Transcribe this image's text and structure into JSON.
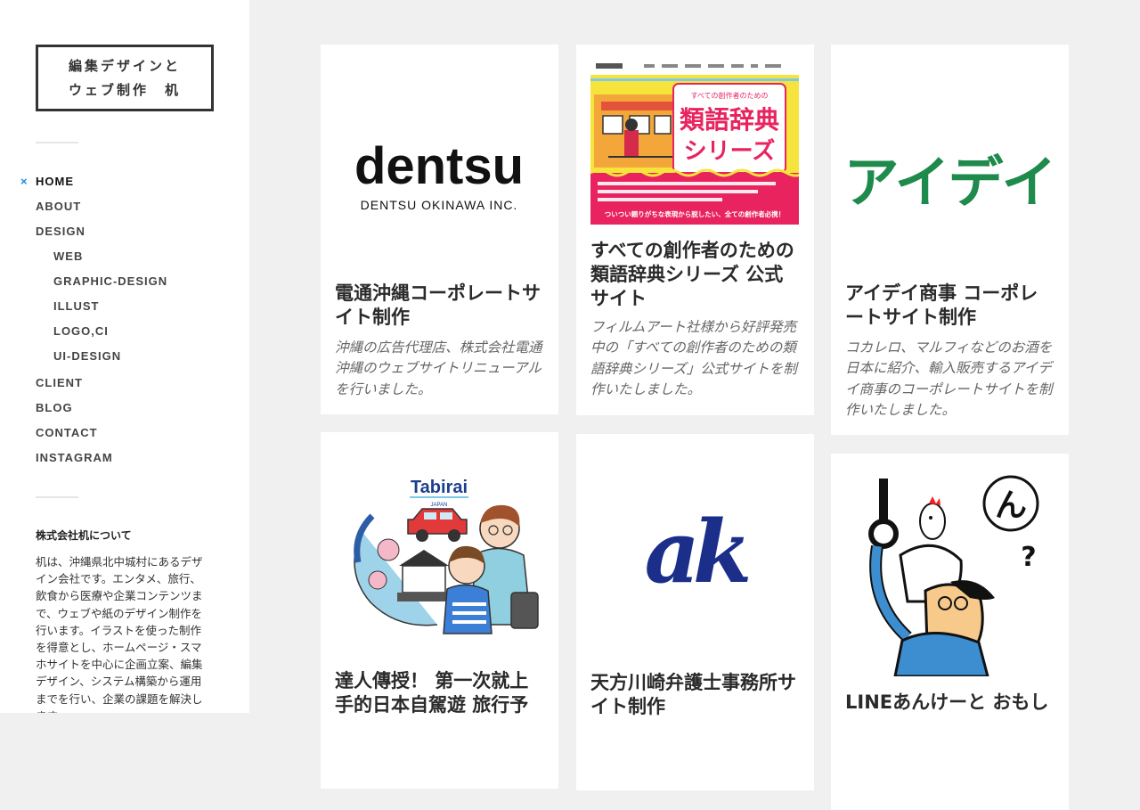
{
  "site": {
    "logo_line1": "編集デザインと",
    "logo_line2": "ウェブ制作　机"
  },
  "nav": {
    "current_marker": "×",
    "items": [
      {
        "label": "HOME"
      },
      {
        "label": "ABOUT"
      },
      {
        "label": "DESIGN"
      },
      {
        "label": "WEB"
      },
      {
        "label": "GRAPHIC-DESIGN"
      },
      {
        "label": "ILLUST"
      },
      {
        "label": "LOGO,CI"
      },
      {
        "label": "UI-DESIGN"
      },
      {
        "label": "CLIENT"
      },
      {
        "label": "BLOG"
      },
      {
        "label": "CONTACT"
      },
      {
        "label": "INSTAGRAM"
      }
    ]
  },
  "about": {
    "title": "株式会社机について",
    "text": "机は、沖縄県北中城村にあるデザイン会社です。エンタメ、旅行、飲食から医療や企業コンテンツまで、ウェブや紙のデザイン制作を行います。イラストを使った制作を得意とし、ホームページ・スマホサイトを中心に企画立案、編集デザイン、システム構築から運用までを行い、企業の課題を解決します。"
  },
  "posts": [
    {
      "title": "電通沖縄コーポレートサイト制作",
      "excerpt": "沖縄の広告代理店、株式会社電通沖縄のウェブサイトリニューアルを行いました。",
      "thumb_logo": "dentsu",
      "thumb_sub": "DENTSU OKINAWA INC."
    },
    {
      "title": "すべての創作者のための類語辞典シリーズ 公式サイト",
      "excerpt": "フィルムアート社様から好評発売中の「すべての創作者のための類語辞典シリーズ」公式サイトを制作いたしました。",
      "thumb_kicker": "すべての創作者のための",
      "thumb_line1": "類語辞典",
      "thumb_line2": "シリーズ",
      "thumb_footer": "ついつい頼りがちな表現から脱したい、全ての創作者必携！"
    },
    {
      "title": "アイデイ商事 コーポレートサイト制作",
      "excerpt": "コカレロ、マルフィなどのお酒を日本に紹介、輸入販売するアイデイ商事のコーポレートサイトを制作いたしました。",
      "thumb_logo": "アイデイ"
    },
    {
      "title": "達人傳授！ 第一次就上手的日本自駕遊 旅行予",
      "thumb_brand": "Tabirai",
      "thumb_brand_sub": "JAPAN"
    },
    {
      "title": "天方川崎弁護士事務所サイト制作",
      "thumb_logo": "ak"
    },
    {
      "title": "LINEあんけーと おもし",
      "thumb_bubble": "ん",
      "thumb_q": "?"
    }
  ],
  "colors": {
    "accent": "#1b8be0",
    "aidei_green": "#1e8a4c",
    "ak_navy": "#1a2e8a",
    "tabirai_navy": "#1c3f8c",
    "ruigo_yellow": "#f6e43c",
    "ruigo_red": "#e8235e"
  }
}
